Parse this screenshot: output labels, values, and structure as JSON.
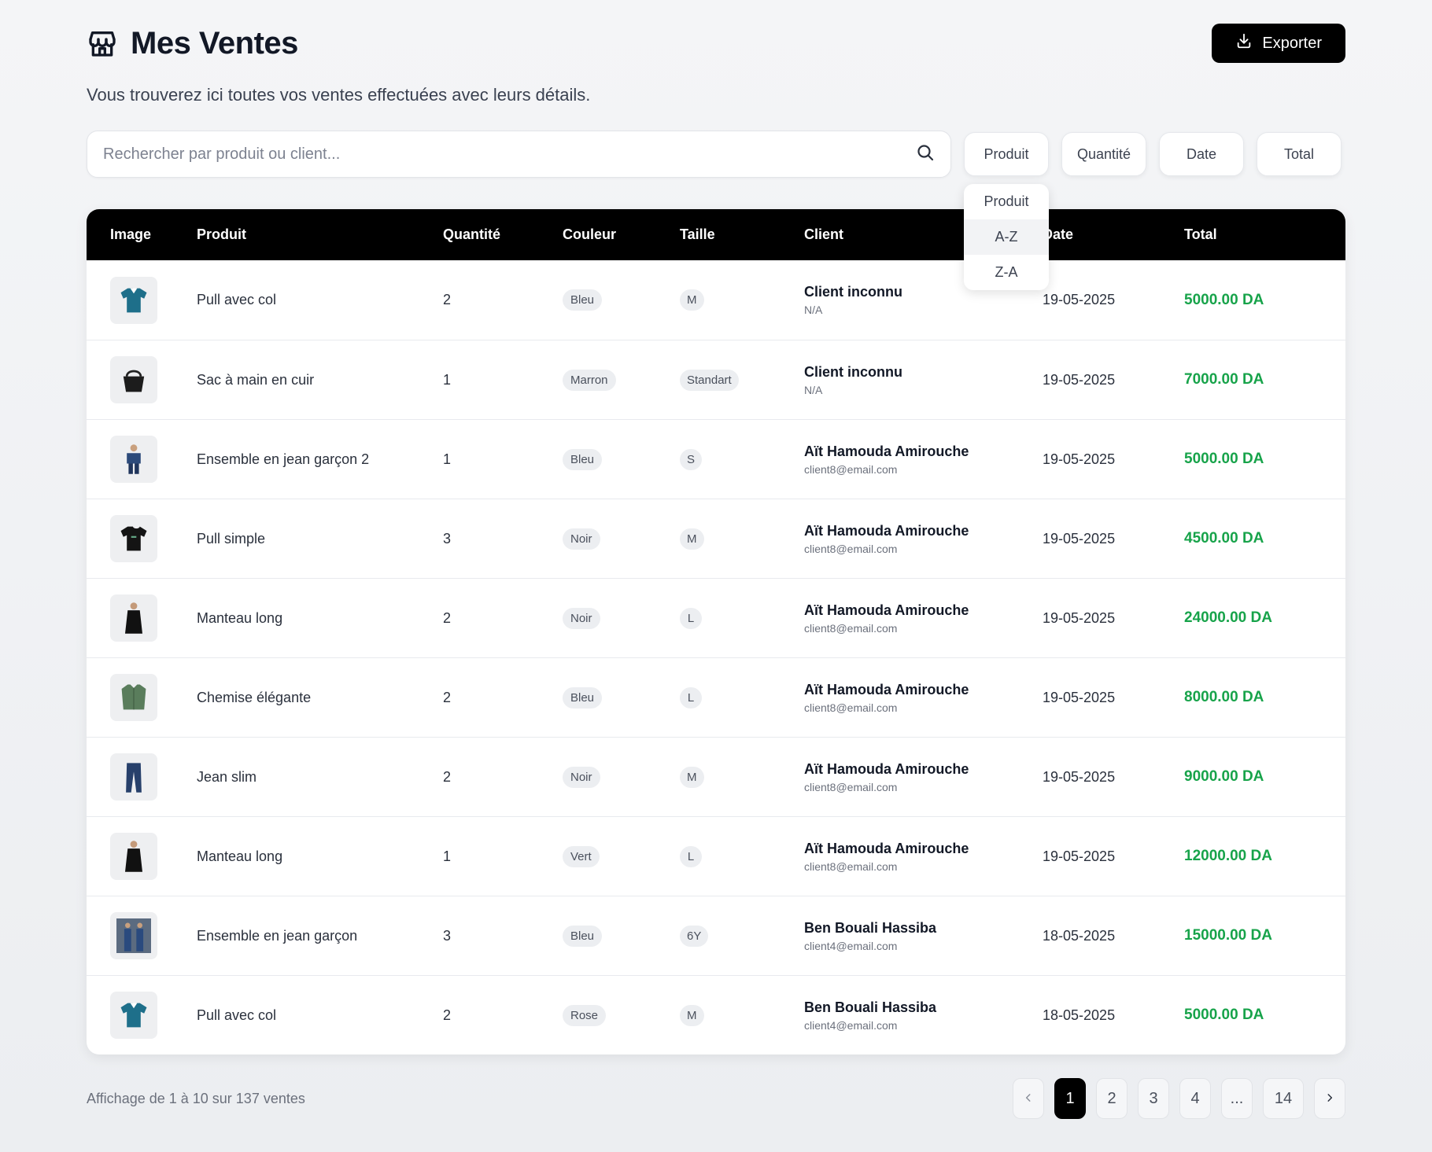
{
  "header": {
    "title": "Mes Ventes",
    "export_label": "Exporter",
    "subtitle": "Vous trouverez ici toutes vos ventes effectuées avec leurs détails."
  },
  "search": {
    "placeholder": "Rechercher par produit ou client..."
  },
  "filters": [
    "Produit",
    "Quantité",
    "Date",
    "Total"
  ],
  "dropdown": {
    "header": "Produit",
    "options": [
      "A-Z",
      "Z-A"
    ]
  },
  "table": {
    "columns": [
      "Image",
      "Produit",
      "Quantité",
      "Couleur",
      "Taille",
      "Client",
      "Date",
      "Total"
    ],
    "rows": [
      {
        "image": "polo-shirt",
        "product": "Pull avec col",
        "qty": "2",
        "color": "Bleu",
        "size": "M",
        "client": "Client inconnu",
        "email": "N/A",
        "date": "19-05-2025",
        "total": "5000.00 DA"
      },
      {
        "image": "leather-bag",
        "product": "Sac à main en cuir",
        "qty": "1",
        "color": "Marron",
        "size": "Standart",
        "client": "Client inconnu",
        "email": "N/A",
        "date": "19-05-2025",
        "total": "7000.00 DA"
      },
      {
        "image": "denim-outfit",
        "product": "Ensemble en jean garçon 2",
        "qty": "1",
        "color": "Bleu",
        "size": "S",
        "client": "Aït Hamouda Amirouche",
        "email": "client8@email.com",
        "date": "19-05-2025",
        "total": "5000.00 DA"
      },
      {
        "image": "tshirt",
        "product": "Pull simple",
        "qty": "3",
        "color": "Noir",
        "size": "M",
        "client": "Aït Hamouda Amirouche",
        "email": "client8@email.com",
        "date": "19-05-2025",
        "total": "4500.00 DA"
      },
      {
        "image": "long-coat",
        "product": "Manteau long",
        "qty": "2",
        "color": "Noir",
        "size": "L",
        "client": "Aït Hamouda Amirouche",
        "email": "client8@email.com",
        "date": "19-05-2025",
        "total": "24000.00 DA"
      },
      {
        "image": "green-shirt",
        "product": "Chemise élégante",
        "qty": "2",
        "color": "Bleu",
        "size": "L",
        "client": "Aït Hamouda Amirouche",
        "email": "client8@email.com",
        "date": "19-05-2025",
        "total": "8000.00 DA"
      },
      {
        "image": "jeans",
        "product": "Jean slim",
        "qty": "2",
        "color": "Noir",
        "size": "M",
        "client": "Aït Hamouda Amirouche",
        "email": "client8@email.com",
        "date": "19-05-2025",
        "total": "9000.00 DA"
      },
      {
        "image": "long-coat",
        "product": "Manteau long",
        "qty": "1",
        "color": "Vert",
        "size": "L",
        "client": "Aït Hamouda Amirouche",
        "email": "client8@email.com",
        "date": "19-05-2025",
        "total": "12000.00 DA"
      },
      {
        "image": "denim-kids",
        "product": "Ensemble en jean garçon",
        "qty": "3",
        "color": "Bleu",
        "size": "6Y",
        "client": "Ben Bouali Hassiba",
        "email": "client4@email.com",
        "date": "18-05-2025",
        "total": "15000.00 DA"
      },
      {
        "image": "polo-shirt",
        "product": "Pull avec col",
        "qty": "2",
        "color": "Rose",
        "size": "M",
        "client": "Ben Bouali Hassiba",
        "email": "client4@email.com",
        "date": "18-05-2025",
        "total": "5000.00 DA"
      }
    ]
  },
  "footer": {
    "showing": "Affichage de 1 à 10 sur 137 ventes",
    "pages": [
      "1",
      "2",
      "3",
      "4",
      "...",
      "14"
    ],
    "active_page": "1"
  },
  "colors": {
    "accent": "#000000",
    "total_green": "#17a34a"
  }
}
